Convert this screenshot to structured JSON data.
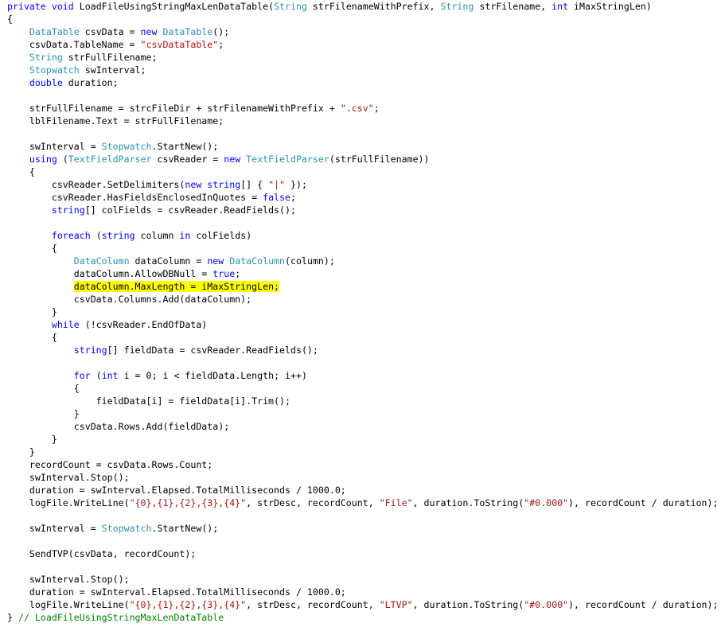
{
  "editor": {
    "language": "C#",
    "colors": {
      "keyword": "#0000ff",
      "type": "#2b91af",
      "string": "#a31515",
      "comment": "#008000",
      "highlight": "#ffff00",
      "plain": "#000000"
    },
    "highlighted_line": 22,
    "lines": [
      [
        [
          "kw",
          "private void "
        ],
        [
          "p",
          "LoadFileUsingStringMaxLenDataTable("
        ],
        [
          "ty",
          "String"
        ],
        [
          "p",
          " strFilenameWithPrefix, "
        ],
        [
          "ty",
          "String"
        ],
        [
          "p",
          " strFilename, "
        ],
        [
          "kw",
          "int"
        ],
        [
          "p",
          " iMaxStringLen)"
        ]
      ],
      [
        [
          "p",
          "{"
        ]
      ],
      [
        [
          "p",
          "    "
        ],
        [
          "ty",
          "DataTable"
        ],
        [
          "p",
          " csvData = "
        ],
        [
          "kw",
          "new "
        ],
        [
          "ty",
          "DataTable"
        ],
        [
          "p",
          "();"
        ]
      ],
      [
        [
          "p",
          "    csvData.TableName = "
        ],
        [
          "st",
          "\"csvDataTable\""
        ],
        [
          "p",
          ";"
        ]
      ],
      [
        [
          "p",
          "    "
        ],
        [
          "ty",
          "String"
        ],
        [
          "p",
          " strFullFilename;"
        ]
      ],
      [
        [
          "p",
          "    "
        ],
        [
          "ty",
          "Stopwatch"
        ],
        [
          "p",
          " swInterval;"
        ]
      ],
      [
        [
          "p",
          "    "
        ],
        [
          "kw",
          "double"
        ],
        [
          "p",
          " duration;"
        ]
      ],
      [],
      [
        [
          "p",
          "    strFullFilename = strcFileDir + strFilenameWithPrefix + "
        ],
        [
          "st",
          "\".csv\""
        ],
        [
          "p",
          ";"
        ]
      ],
      [
        [
          "p",
          "    lblFilename.Text = strFullFilename;"
        ]
      ],
      [],
      [
        [
          "p",
          "    swInterval = "
        ],
        [
          "ty",
          "Stopwatch"
        ],
        [
          "p",
          ".StartNew();"
        ]
      ],
      [
        [
          "p",
          "    "
        ],
        [
          "kw",
          "using"
        ],
        [
          "p",
          " ("
        ],
        [
          "ty",
          "TextFieldParser"
        ],
        [
          "p",
          " csvReader = "
        ],
        [
          "kw",
          "new "
        ],
        [
          "ty",
          "TextFieldParser"
        ],
        [
          "p",
          "(strFullFilename))"
        ]
      ],
      [
        [
          "p",
          "    {"
        ]
      ],
      [
        [
          "p",
          "        csvReader.SetDelimiters("
        ],
        [
          "kw",
          "new string"
        ],
        [
          "p",
          "[] { "
        ],
        [
          "st",
          "\"|\""
        ],
        [
          "p",
          " });"
        ]
      ],
      [
        [
          "p",
          "        csvReader.HasFieldsEnclosedInQuotes = "
        ],
        [
          "kw",
          "false"
        ],
        [
          "p",
          ";"
        ]
      ],
      [
        [
          "p",
          "        "
        ],
        [
          "kw",
          "string"
        ],
        [
          "p",
          "[] colFields = csvReader.ReadFields();"
        ]
      ],
      [],
      [
        [
          "p",
          "        "
        ],
        [
          "kw",
          "foreach"
        ],
        [
          "p",
          " ("
        ],
        [
          "kw",
          "string"
        ],
        [
          "p",
          " column "
        ],
        [
          "kw",
          "in"
        ],
        [
          "p",
          " colFields)"
        ]
      ],
      [
        [
          "p",
          "        {"
        ]
      ],
      [
        [
          "p",
          "            "
        ],
        [
          "ty",
          "DataColumn"
        ],
        [
          "p",
          " dataColumn = "
        ],
        [
          "kw",
          "new "
        ],
        [
          "ty",
          "DataColumn"
        ],
        [
          "p",
          "(column);"
        ]
      ],
      [
        [
          "p",
          "            dataColumn.AllowDBNull = "
        ],
        [
          "kw",
          "true"
        ],
        [
          "p",
          ";"
        ]
      ],
      [
        [
          "p",
          "            "
        ],
        [
          "hl",
          "dataColumn.MaxLength = iMaxStringLen;"
        ]
      ],
      [
        [
          "p",
          "            csvData.Columns.Add(dataColumn);"
        ]
      ],
      [
        [
          "p",
          "        }"
        ]
      ],
      [
        [
          "p",
          "        "
        ],
        [
          "kw",
          "while"
        ],
        [
          "p",
          " (!csvReader.EndOfData)"
        ]
      ],
      [
        [
          "p",
          "        {"
        ]
      ],
      [
        [
          "p",
          "            "
        ],
        [
          "kw",
          "string"
        ],
        [
          "p",
          "[] fieldData = csvReader.ReadFields();"
        ]
      ],
      [],
      [
        [
          "p",
          "            "
        ],
        [
          "kw",
          "for"
        ],
        [
          "p",
          " ("
        ],
        [
          "kw",
          "int"
        ],
        [
          "p",
          " i = 0; i < fieldData.Length; i++)"
        ]
      ],
      [
        [
          "p",
          "            {"
        ]
      ],
      [
        [
          "p",
          "                fieldData[i] = fieldData[i].Trim();"
        ]
      ],
      [
        [
          "p",
          "            }"
        ]
      ],
      [
        [
          "p",
          "            csvData.Rows.Add(fieldData);"
        ]
      ],
      [
        [
          "p",
          "        }"
        ]
      ],
      [
        [
          "p",
          "    }"
        ]
      ],
      [
        [
          "p",
          "    recordCount = csvData.Rows.Count;"
        ]
      ],
      [
        [
          "p",
          "    swInterval.Stop();"
        ]
      ],
      [
        [
          "p",
          "    duration = swInterval.Elapsed.TotalMilliseconds / 1000.0;"
        ]
      ],
      [
        [
          "p",
          "    logFile.WriteLine("
        ],
        [
          "st",
          "\"{0},{1},{2},{3},{4}\""
        ],
        [
          "p",
          ", strDesc, recordCount, "
        ],
        [
          "st",
          "\"File\""
        ],
        [
          "p",
          ", duration.ToString("
        ],
        [
          "st",
          "\"#0.000\""
        ],
        [
          "p",
          "), recordCount / duration);"
        ]
      ],
      [],
      [
        [
          "p",
          "    swInterval = "
        ],
        [
          "ty",
          "Stopwatch"
        ],
        [
          "p",
          ".StartNew();"
        ]
      ],
      [],
      [
        [
          "p",
          "    SendTVP(csvData, recordCount);"
        ]
      ],
      [],
      [
        [
          "p",
          "    swInterval.Stop();"
        ]
      ],
      [
        [
          "p",
          "    duration = swInterval.Elapsed.TotalMilliseconds / 1000.0;"
        ]
      ],
      [
        [
          "p",
          "    logFile.WriteLine("
        ],
        [
          "st",
          "\"{0},{1},{2},{3},{4}\""
        ],
        [
          "p",
          ", strDesc, recordCount, "
        ],
        [
          "st",
          "\"LTVP\""
        ],
        [
          "p",
          ", duration.ToString("
        ],
        [
          "st",
          "\"#0.000\""
        ],
        [
          "p",
          "), recordCount / duration);"
        ]
      ],
      [
        [
          "p",
          "} "
        ],
        [
          "cm",
          "// LoadFileUsingStringMaxLenDataTable"
        ]
      ]
    ]
  }
}
